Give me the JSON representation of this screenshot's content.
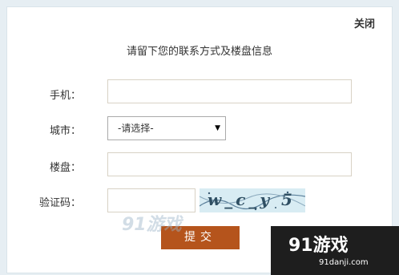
{
  "dialog": {
    "close_label": "关闭",
    "title": "请留下您的联系方式及楼盘信息"
  },
  "form": {
    "phone_label": "手机：",
    "city_label": "城市：",
    "city_selected": "-请选择-",
    "building_label": "楼盘：",
    "captcha_label": "验证码：",
    "captcha_text": "w_c_y 5",
    "submit_label": "提交"
  },
  "watermark": {
    "logo": "91游戏",
    "url": "91danji.com"
  }
}
